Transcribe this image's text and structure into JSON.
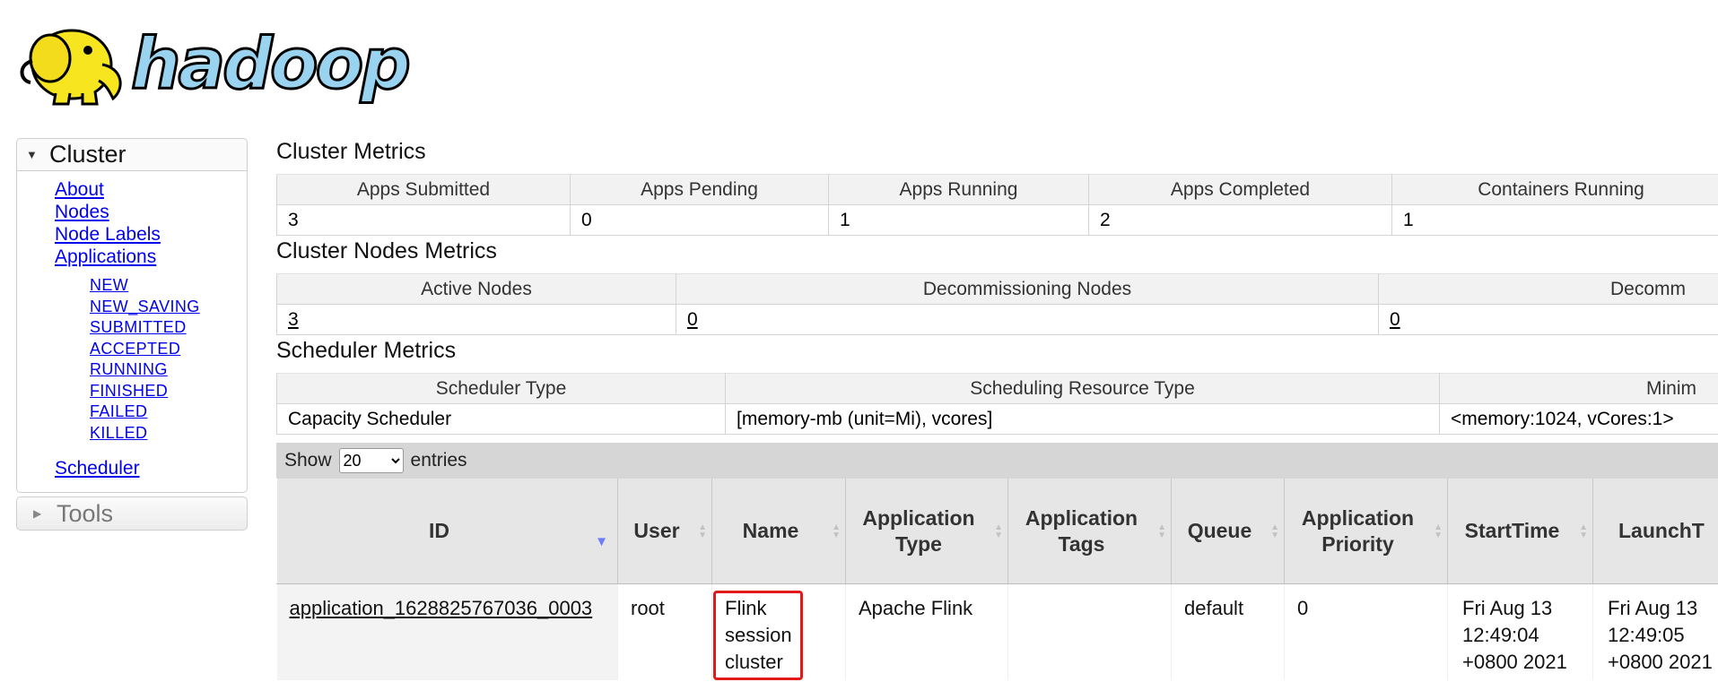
{
  "logo": {
    "alt": "hadoop"
  },
  "sidebar": {
    "cluster_title": "Cluster",
    "tools_title": "Tools",
    "links": [
      "About",
      "Nodes",
      "Node Labels",
      "Applications"
    ],
    "app_states": [
      "NEW",
      "NEW_SAVING",
      "SUBMITTED",
      "ACCEPTED",
      "RUNNING",
      "FINISHED",
      "FAILED",
      "KILLED"
    ],
    "scheduler": "Scheduler"
  },
  "cluster_metrics": {
    "title": "Cluster Metrics",
    "headers": [
      "Apps Submitted",
      "Apps Pending",
      "Apps Running",
      "Apps Completed",
      "Containers Running"
    ],
    "values": [
      "3",
      "0",
      "1",
      "2",
      "1"
    ]
  },
  "nodes_metrics": {
    "title": "Cluster Nodes Metrics",
    "headers": [
      "Active Nodes",
      "Decommissioning Nodes",
      "Decomm"
    ],
    "values": [
      "3",
      "0",
      "0"
    ]
  },
  "scheduler_metrics": {
    "title": "Scheduler Metrics",
    "headers": [
      "Scheduler Type",
      "Scheduling Resource Type",
      "Minim"
    ],
    "values": [
      "Capacity Scheduler",
      "[memory-mb (unit=Mi), vcores]",
      "<memory:1024, vCores:1>"
    ]
  },
  "entries": {
    "show": "Show",
    "selected": "20",
    "suffix": "entries"
  },
  "apps_table": {
    "headers": [
      "ID",
      "User",
      "Name",
      "Application Type",
      "Application Tags",
      "Queue",
      "Application Priority",
      "StartTime",
      "LaunchT"
    ],
    "row": {
      "id": "application_1628825767036_0003",
      "user": "root",
      "name": "Flink session cluster",
      "type": "Apache Flink",
      "tags": "",
      "queue": "default",
      "priority": "0",
      "start": "Fri Aug 13 12:49:04 +0800 2021",
      "launch": "Fri Aug 13 12:49:05 +0800 2021"
    }
  },
  "colors": {
    "logo_blue": "#9ad3ef",
    "logo_yellow": "#f7e51f",
    "highlight": "#e31919",
    "sort_active": "#6d7cff"
  }
}
